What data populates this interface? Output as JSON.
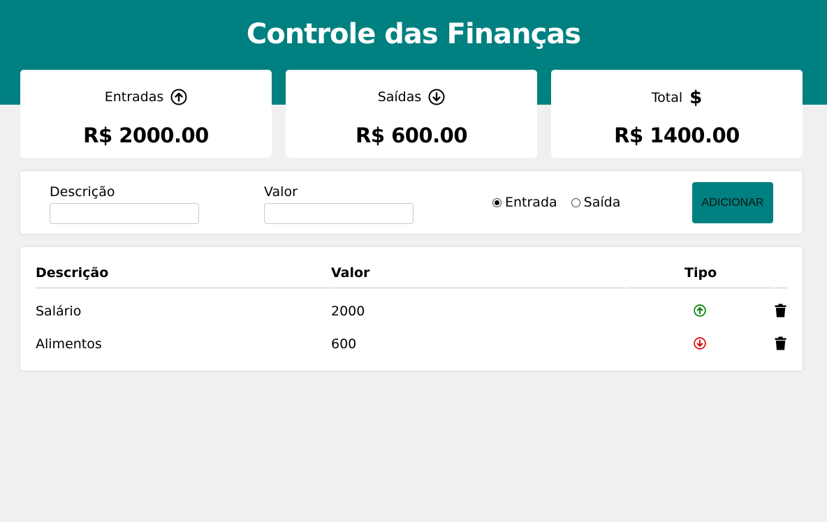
{
  "header": {
    "title": "Controle das Finanças",
    "color": "#008080"
  },
  "summary": [
    {
      "label": "Entradas",
      "icon": "arrow-up-circle-icon",
      "value": "R$ 2000.00"
    },
    {
      "label": "Saídas",
      "icon": "arrow-down-circle-icon",
      "value": "R$ 600.00"
    },
    {
      "label": "Total",
      "icon": "dollar-icon",
      "icon_glyph": "$",
      "value": "R$ 1400.00"
    }
  ],
  "form": {
    "description_label": "Descrição",
    "description_value": "",
    "value_label": "Valor",
    "value_value": "",
    "radio_options": [
      {
        "label": "Entrada",
        "checked": true
      },
      {
        "label": "Saída",
        "checked": false
      }
    ],
    "submit_label": "ADICIONAR"
  },
  "table": {
    "headers": [
      "Descrição",
      "Valor",
      "Tipo"
    ],
    "rows": [
      {
        "description": "Salário",
        "value": "2000",
        "type": "entrada",
        "type_icon": "arrow-up-circle-icon",
        "type_color": "#008000"
      },
      {
        "description": "Alimentos",
        "value": "600",
        "type": "saida",
        "type_icon": "arrow-down-circle-icon",
        "type_color": "#e00000"
      }
    ]
  }
}
